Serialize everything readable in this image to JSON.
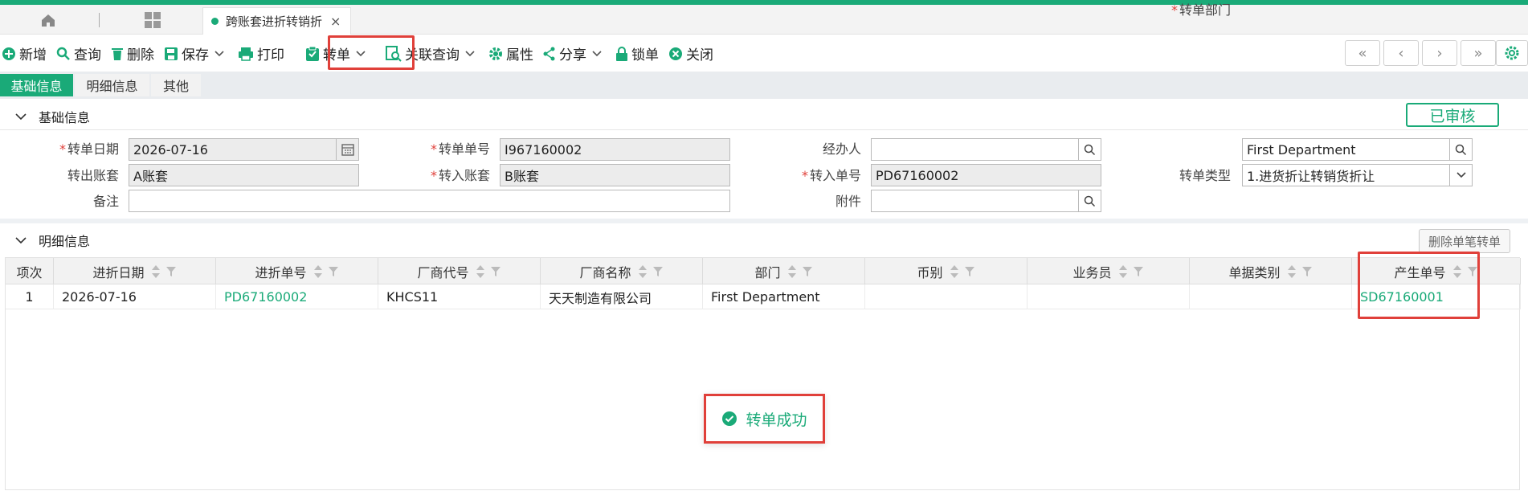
{
  "tabs": {
    "doc_tab_label": "跨账套进折转销折",
    "close_glyph": "×"
  },
  "toolbar": {
    "new": "新增",
    "query": "查询",
    "delete": "删除",
    "save": "保存",
    "print": "打印",
    "transfer": "转单",
    "related_query": "关联查询",
    "properties": "属性",
    "share": "分享",
    "lock": "锁单",
    "close": "关闭"
  },
  "pager": {
    "first": "«",
    "prev": "‹",
    "next": "›",
    "last": "»"
  },
  "subtabs": [
    "基础信息",
    "明细信息",
    "其他"
  ],
  "basic_section": {
    "title": "基础信息",
    "status": "已审核",
    "fields": {
      "transfer_date_label": "转单日期",
      "transfer_date": "2026-07-16",
      "transfer_no_label": "转单单号",
      "transfer_no": "I967160002",
      "handler_label": "经办人",
      "handler": "",
      "dept_label": "转单部门",
      "dept": "First Department",
      "out_book_label": "转出账套",
      "out_book": "A账套",
      "in_book_label": "转入账套",
      "in_book": "B账套",
      "in_no_label": "转入单号",
      "in_no": "PD67160002",
      "type_label": "转单类型",
      "type": "1.进货折让转销货折让",
      "remark_label": "备注",
      "remark": "",
      "attachment_label": "附件",
      "attachment": ""
    }
  },
  "detail_section": {
    "title": "明细信息",
    "delete_single_label": "删除单笔转单",
    "columns": [
      "项次",
      "进折日期",
      "进折单号",
      "厂商代号",
      "厂商名称",
      "部门",
      "币别",
      "业务员",
      "单据类别",
      "产生单号"
    ],
    "rows": [
      {
        "item": "1",
        "date": "2026-07-16",
        "in_no": "PD67160002",
        "vendor_code": "KHCS11",
        "vendor_name": "天天制造有限公司",
        "dept": "First Department",
        "currency": "",
        "salesman": "",
        "doc_type": "",
        "generated_no": "SD67160001"
      }
    ]
  },
  "toast": {
    "message": "转单成功"
  },
  "colors": {
    "accent": "#1aaa78",
    "highlight": "#e0403a"
  }
}
